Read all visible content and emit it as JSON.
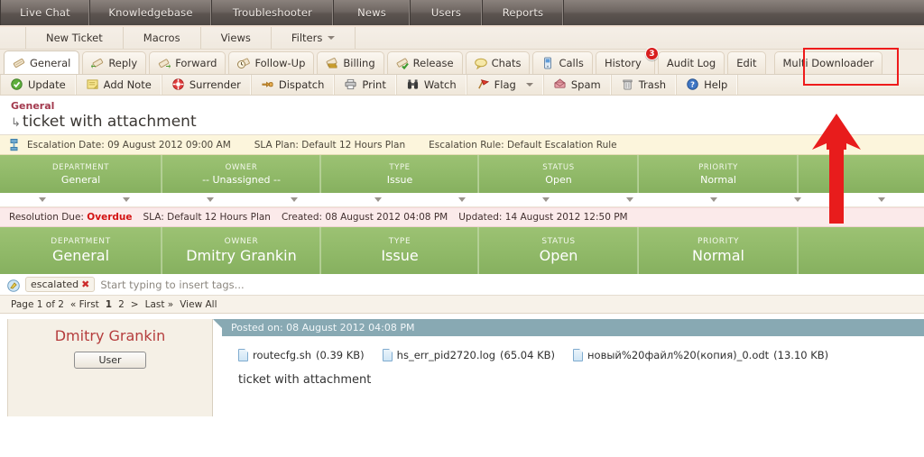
{
  "topnav": {
    "items": [
      {
        "label": "Live Chat",
        "width": 100
      },
      {
        "label": "Knowledgebase",
        "width": 135
      },
      {
        "label": "Troubleshooter",
        "width": 135
      },
      {
        "label": "News",
        "width": 85
      },
      {
        "label": "Users",
        "width": 80
      },
      {
        "label": "Reports",
        "width": 90
      }
    ]
  },
  "subnav": {
    "items": [
      {
        "label": "New Ticket",
        "caret": false
      },
      {
        "label": "Macros",
        "caret": false
      },
      {
        "label": "Views",
        "caret": false
      },
      {
        "label": "Filters",
        "caret": true
      }
    ]
  },
  "tabs": [
    {
      "label": "General",
      "icon": "note-icon",
      "active": true,
      "badge": null
    },
    {
      "label": "Reply",
      "icon": "reply-icon",
      "active": false,
      "badge": null
    },
    {
      "label": "Forward",
      "icon": "forward-icon",
      "active": false,
      "badge": null
    },
    {
      "label": "Follow-Up",
      "icon": "clock-icon",
      "active": false,
      "badge": null
    },
    {
      "label": "Billing",
      "icon": "money-icon",
      "active": false,
      "badge": null
    },
    {
      "label": "Release",
      "icon": "check-icon",
      "active": false,
      "badge": null
    },
    {
      "label": "Chats",
      "icon": "speech-bubble-icon",
      "active": false,
      "badge": null
    },
    {
      "label": "Calls",
      "icon": "phone-icon",
      "active": false,
      "badge": null
    },
    {
      "label": "History",
      "icon": null,
      "active": false,
      "badge": "3"
    },
    {
      "label": "Audit Log",
      "icon": null,
      "active": false,
      "badge": null
    },
    {
      "label": "Edit",
      "icon": null,
      "active": false,
      "badge": null
    },
    {
      "label": "Multi Downloader",
      "icon": null,
      "active": false,
      "badge": null,
      "highlighted": true
    }
  ],
  "toolbar": {
    "items": [
      {
        "label": "Update",
        "icon": "check-circle-icon"
      },
      {
        "label": "Add Note",
        "icon": "note-yellow-icon"
      },
      {
        "label": "Surrender",
        "icon": "lifebuoy-icon"
      },
      {
        "label": "Dispatch",
        "icon": "pointing-hand-icon"
      },
      {
        "label": "Print",
        "icon": "printer-icon"
      },
      {
        "label": "Watch",
        "icon": "binoculars-icon"
      },
      {
        "label": "Flag",
        "icon": "flag-icon",
        "caret": true
      },
      {
        "label": "Spam",
        "icon": "spam-icon"
      },
      {
        "label": "Trash",
        "icon": "trash-icon"
      },
      {
        "label": "Help",
        "icon": "help-icon"
      }
    ]
  },
  "ticket": {
    "department": "General",
    "subject": "ticket with attachment",
    "escalation": {
      "date_label": "Escalation Date: 09 August 2012 09:00 AM",
      "sla_label": "SLA Plan: Default 12 Hours Plan",
      "rule_label": "Escalation Rule: Default Escalation Rule"
    },
    "resolution": {
      "due_label": "Resolution Due:",
      "due_value": "Overdue",
      "sla_label": "SLA: Default 12 Hours Plan",
      "created_label": "Created: 08 August 2012 04:08 PM",
      "updated_label": "Updated: 14 August 2012 12:50 PM"
    },
    "status_top": [
      {
        "label": "DEPARTMENT",
        "value": "General",
        "width": 180
      },
      {
        "label": "OWNER",
        "value": "-- Unassigned --",
        "width": 176
      },
      {
        "label": "TYPE",
        "value": "Issue",
        "width": 175
      },
      {
        "label": "STATUS",
        "value": "Open",
        "width": 177
      },
      {
        "label": "PRIORITY",
        "value": "Normal",
        "width": 177
      },
      {
        "label": "",
        "value": "",
        "width": 139
      }
    ],
    "status_bottom": [
      {
        "label": "DEPARTMENT",
        "value": "General",
        "width": 180
      },
      {
        "label": "OWNER",
        "value": "Dmitry Grankin",
        "width": 176
      },
      {
        "label": "TYPE",
        "value": "Issue",
        "width": 175
      },
      {
        "label": "STATUS",
        "value": "Open",
        "width": 177
      },
      {
        "label": "PRIORITY",
        "value": "Normal",
        "width": 177
      },
      {
        "label": "",
        "value": "",
        "width": 139
      }
    ],
    "arrow_count": 11
  },
  "tags": {
    "chips": [
      {
        "label": "escalated",
        "remove": "✖"
      }
    ],
    "placeholder": "Start typing to insert tags..."
  },
  "pager": {
    "summary": "Page 1 of 2",
    "first": "« First",
    "pages": [
      "1",
      "2"
    ],
    "current": "1",
    "next": ">",
    "last": "Last »",
    "view_all": "View All"
  },
  "post": {
    "author": "Dmitry Grankin",
    "role": "User",
    "posted_on": "Posted on: 08 August 2012 04:08 PM",
    "attachments": [
      {
        "name": "routecfg.sh",
        "size": "(0.39 KB)"
      },
      {
        "name": "hs_err_pid2720.log",
        "size": "(65.04 KB)"
      },
      {
        "name": "новый%20файл%20(копия)_0.odt",
        "size": "(13.10 KB)"
      }
    ],
    "body": "ticket with attachment"
  },
  "colors": {
    "accent_red": "#ee1b1b",
    "green_bar": "#8fb867",
    "escalation_bg": "#fcf5dc",
    "resolution_bg": "#fbeaea",
    "posted_bar": "#88a9b3",
    "dept_red": "#a33a4e"
  }
}
